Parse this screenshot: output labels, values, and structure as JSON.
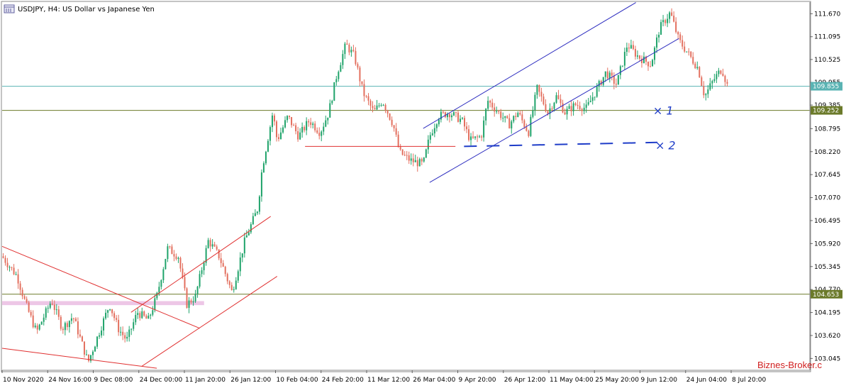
{
  "header": {
    "title": "USDJPY, H4:  US Dollar vs Japanese Yen"
  },
  "watermark": "Biznes-Broker.c",
  "colors": {
    "bull": "#1fa36a",
    "bear": "#e36f5e",
    "channel_upper": "#2f2fc0",
    "trend_red": "#e03030",
    "hline_cyan": "#5ab3b3",
    "hline_olive": "#6b7a2a",
    "zone": "#e8b8e0",
    "marks": "#1e3cc8"
  },
  "chart_data": {
    "type": "candlestick",
    "symbol": "USDJPY",
    "timeframe": "H4",
    "ylim": [
      102.75,
      111.96
    ],
    "y_ticks": [
      "111.670",
      "111.095",
      "110.525",
      "109.955",
      "109.385",
      "108.795",
      "108.220",
      "107.645",
      "107.070",
      "106.495",
      "105.920",
      "105.345",
      "104.770",
      "104.195",
      "103.620",
      "103.045"
    ],
    "x_labels": [
      "10 Nov 2020",
      "24 Nov 16:00",
      "9 Dec 08:00",
      "24 Dec 00:00",
      "11 Jan 20:00",
      "26 Jan 12:00",
      "10 Feb 04:00",
      "24 Feb 20:00",
      "11 Mar 12:00",
      "26 Mar 04:00",
      "9 Apr 20:00",
      "26 Apr 12:00",
      "11 May 04:00",
      "25 May 20:00",
      "9 Jun 12:00",
      "24 Jun 04:00",
      "8 Jul 20:00"
    ],
    "price_path": [
      [
        0,
        105.6
      ],
      [
        0.7,
        105.1
      ],
      [
        1.1,
        104.4
      ],
      [
        1.6,
        103.7
      ],
      [
        2.3,
        104.5
      ],
      [
        2.8,
        103.8
      ],
      [
        3.3,
        104.1
      ],
      [
        4.0,
        102.95
      ],
      [
        5.0,
        104.4
      ],
      [
        5.4,
        103.8
      ],
      [
        5.8,
        103.5
      ],
      [
        6.3,
        104.2
      ],
      [
        6.8,
        104.0
      ],
      [
        7.2,
        104.6
      ],
      [
        7.7,
        105.8
      ],
      [
        8.2,
        105.6
      ],
      [
        8.6,
        104.4
      ],
      [
        9.0,
        104.6
      ],
      [
        9.6,
        106.0
      ],
      [
        10.1,
        105.6
      ],
      [
        10.7,
        104.7
      ],
      [
        11.3,
        106.0
      ],
      [
        11.9,
        106.8
      ],
      [
        12.1,
        107.8
      ],
      [
        12.6,
        109.2
      ],
      [
        12.8,
        108.5
      ],
      [
        13.3,
        109.1
      ],
      [
        13.8,
        108.6
      ],
      [
        14.3,
        109.0
      ],
      [
        14.8,
        108.7
      ],
      [
        15.2,
        109.2
      ],
      [
        15.6,
        110.2
      ],
      [
        16.0,
        110.9
      ],
      [
        16.4,
        110.6
      ],
      [
        16.8,
        109.7
      ],
      [
        17.3,
        109.2
      ],
      [
        17.7,
        109.5
      ],
      [
        18.2,
        108.9
      ],
      [
        18.5,
        108.2
      ],
      [
        19.0,
        108.0
      ],
      [
        19.6,
        107.9
      ],
      [
        19.9,
        108.6
      ],
      [
        20.3,
        109.1
      ],
      [
        20.8,
        109.2
      ],
      [
        21.4,
        109.0
      ],
      [
        21.8,
        108.5
      ],
      [
        22.3,
        108.6
      ],
      [
        22.6,
        109.5
      ],
      [
        23.1,
        109.2
      ],
      [
        23.6,
        108.9
      ],
      [
        24.0,
        109.2
      ],
      [
        24.5,
        108.7
      ],
      [
        24.9,
        109.8
      ],
      [
        25.4,
        109.2
      ],
      [
        25.8,
        109.6
      ],
      [
        26.2,
        109.2
      ],
      [
        26.7,
        109.4
      ],
      [
        27.2,
        109.3
      ],
      [
        27.7,
        109.8
      ],
      [
        28.1,
        110.2
      ],
      [
        28.6,
        109.9
      ],
      [
        29.1,
        110.9
      ],
      [
        29.6,
        110.6
      ],
      [
        30.2,
        110.4
      ],
      [
        30.6,
        111.3
      ],
      [
        31.1,
        111.7
      ],
      [
        31.5,
        111.0
      ],
      [
        31.9,
        110.7
      ],
      [
        32.4,
        110.3
      ],
      [
        32.7,
        109.6
      ],
      [
        33.1,
        110.0
      ],
      [
        33.5,
        110.3
      ],
      [
        33.8,
        109.8
      ]
    ],
    "price_range": [
      0,
      34
    ],
    "horizontal_levels": [
      {
        "price": 109.855,
        "label": "109.855",
        "style": "cyan"
      },
      {
        "price": 109.252,
        "label": "109.252",
        "style": "olive"
      },
      {
        "price": 104.653,
        "label": "104.653",
        "style": "olive"
      }
    ],
    "trendlines": [
      {
        "name": "upper-channel-top",
        "x1": 19.6,
        "y1": 108.8,
        "x2": 29.5,
        "y2": 111.95,
        "style": "blue"
      },
      {
        "name": "upper-channel-bottom",
        "x1": 19.9,
        "y1": 107.45,
        "x2": 31.5,
        "y2": 111.05,
        "style": "blue"
      },
      {
        "name": "support-red",
        "x1": 14.1,
        "y1": 108.35,
        "x2": 21.1,
        "y2": 108.35,
        "style": "red"
      },
      {
        "name": "falling-wedge-top",
        "x1": 0.0,
        "y1": 105.85,
        "x2": 9.2,
        "y2": 103.8,
        "style": "red"
      },
      {
        "name": "falling-wedge-bottom",
        "x1": 0.0,
        "y1": 103.3,
        "x2": 7.2,
        "y2": 102.8,
        "style": "red"
      },
      {
        "name": "rising-channel-top",
        "x1": 6.0,
        "y1": 104.2,
        "x2": 12.5,
        "y2": 106.6,
        "style": "red"
      },
      {
        "name": "rising-channel-bottom",
        "x1": 6.5,
        "y1": 102.85,
        "x2": 12.8,
        "y2": 105.1,
        "style": "red"
      }
    ],
    "zone": {
      "y_top": 104.48,
      "y_bottom": 104.38,
      "x1": 0.0,
      "x2": 9.4
    },
    "annotations": [
      {
        "text": "× 1",
        "x": 30.3,
        "y": 109.25
      },
      {
        "text": "× 2",
        "x": 30.4,
        "y": 108.38
      }
    ],
    "dashed_target": {
      "x1": 21.5,
      "y1": 108.35,
      "x2": 30.5,
      "y2": 108.45
    }
  }
}
